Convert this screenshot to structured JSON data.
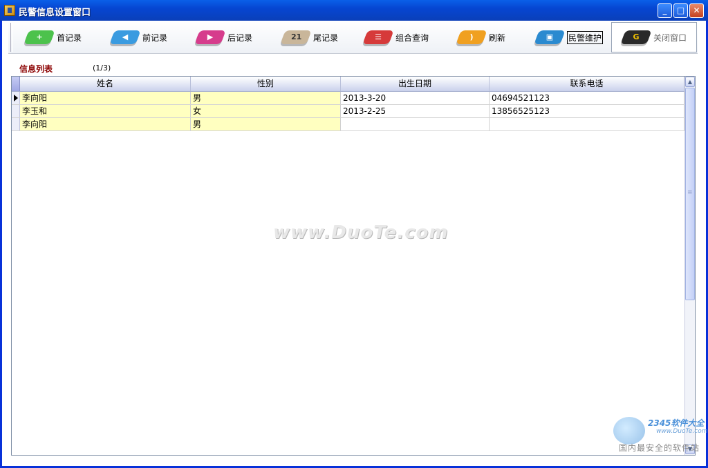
{
  "window": {
    "title": "民警信息设置窗口"
  },
  "toolbar": {
    "buttons": [
      {
        "label": "首记录",
        "icon": "first-record-icon",
        "color": "#4cc24c",
        "glyph": "+"
      },
      {
        "label": "前记录",
        "icon": "previous-record-icon",
        "color": "#3a9be0",
        "glyph": "◀"
      },
      {
        "label": "后记录",
        "icon": "next-record-icon",
        "color": "#d63c8c",
        "glyph": "▶"
      },
      {
        "label": "尾记录",
        "icon": "last-record-calendar-icon",
        "color": "#c9b69a",
        "glyph": "21"
      },
      {
        "label": "组合查询",
        "icon": "combined-query-icon",
        "color": "#d63a3a",
        "glyph": "☰"
      },
      {
        "label": "刷新",
        "icon": "refresh-rss-icon",
        "color": "#f0a020",
        "glyph": "))"
      },
      {
        "label": "民警维护",
        "icon": "police-maintenance-icon",
        "color": "#2a8ad0",
        "glyph": "▣"
      },
      {
        "label": "关闭窗口",
        "icon": "close-window-icon",
        "color": "#2a2a2a",
        "glyph": "G"
      }
    ]
  },
  "list": {
    "title": "信息列表",
    "count": "(1/3)"
  },
  "grid": {
    "columns": [
      "姓名",
      "性别",
      "出生日期",
      "联系电话"
    ],
    "rows": [
      {
        "name": "李向阳",
        "gender": "男",
        "birth": "2013-3-20",
        "phone": "04694521123",
        "current": true
      },
      {
        "name": "李玉和",
        "gender": "女",
        "birth": "2013-2-25",
        "phone": "13856525123",
        "current": false
      },
      {
        "name": "李向阳",
        "gender": "男",
        "birth": "",
        "phone": "",
        "current": false
      }
    ]
  },
  "watermarks": {
    "center": "www.DuoTe.com",
    "corner_brand": "2345软件大全",
    "corner_url": "www.DuoTe.com",
    "corner_slogan": "国内最安全的软件站"
  }
}
